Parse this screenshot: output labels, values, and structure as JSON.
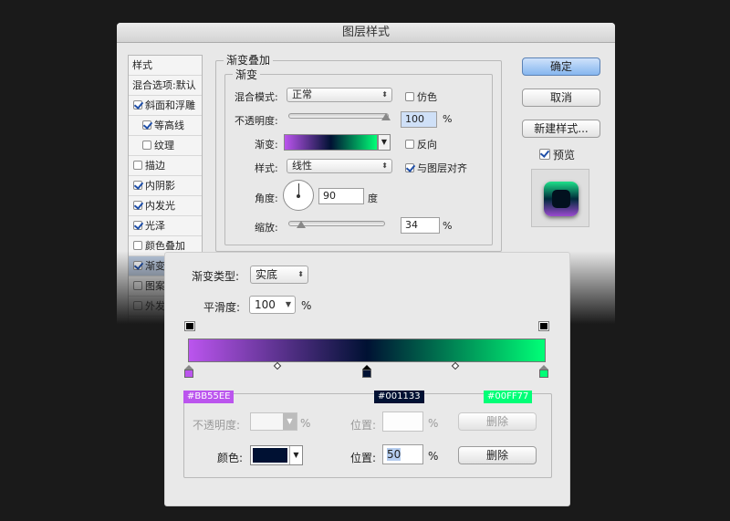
{
  "dialog": {
    "title": "图层样式"
  },
  "style_list": {
    "header": "样式",
    "blend": "混合选项:默认",
    "items": [
      {
        "label": "斜面和浮雕",
        "checked": true
      },
      {
        "label": "等高线",
        "checked": true
      },
      {
        "label": "纹理",
        "checked": false
      },
      {
        "label": "描边",
        "checked": false
      },
      {
        "label": "内阴影",
        "checked": true
      },
      {
        "label": "内发光",
        "checked": true
      },
      {
        "label": "光泽",
        "checked": true
      },
      {
        "label": "颜色叠加",
        "checked": false
      },
      {
        "label": "渐变",
        "checked": true
      },
      {
        "label": "图案",
        "checked": false
      },
      {
        "label": "外发",
        "checked": false
      }
    ]
  },
  "overlay": {
    "group_title": "渐变叠加",
    "sub_title": "渐变",
    "blend_label": "混合模式:",
    "blend_value": "正常",
    "dither_label": "仿色",
    "opacity_label": "不透明度:",
    "opacity_value": "100",
    "percent": "%",
    "gradient_label": "渐变:",
    "reverse_label": "反向",
    "style_label": "样式:",
    "style_value": "线性",
    "align_label": "与图层对齐",
    "angle_label": "角度:",
    "angle_value": "90",
    "degree": "度",
    "scale_label": "缩放:",
    "scale_value": "34"
  },
  "buttons": {
    "ok": "确定",
    "cancel": "取消",
    "new_style": "新建样式...",
    "preview": "预览"
  },
  "gradient_editor": {
    "type_label": "渐变类型:",
    "type_value": "实底",
    "smooth_label": "平滑度:",
    "smooth_value": "100",
    "percent": "%",
    "stops": [
      {
        "color": "#BB55EE",
        "label": "#BB55EE"
      },
      {
        "color": "#001133",
        "label": "#001133"
      },
      {
        "color": "#00FF77",
        "label": "#00FF77"
      }
    ],
    "opacity_label": "不透明度:",
    "color_label": "颜色:",
    "position_label": "位置:",
    "position_value": "50",
    "delete_label": "删除"
  }
}
